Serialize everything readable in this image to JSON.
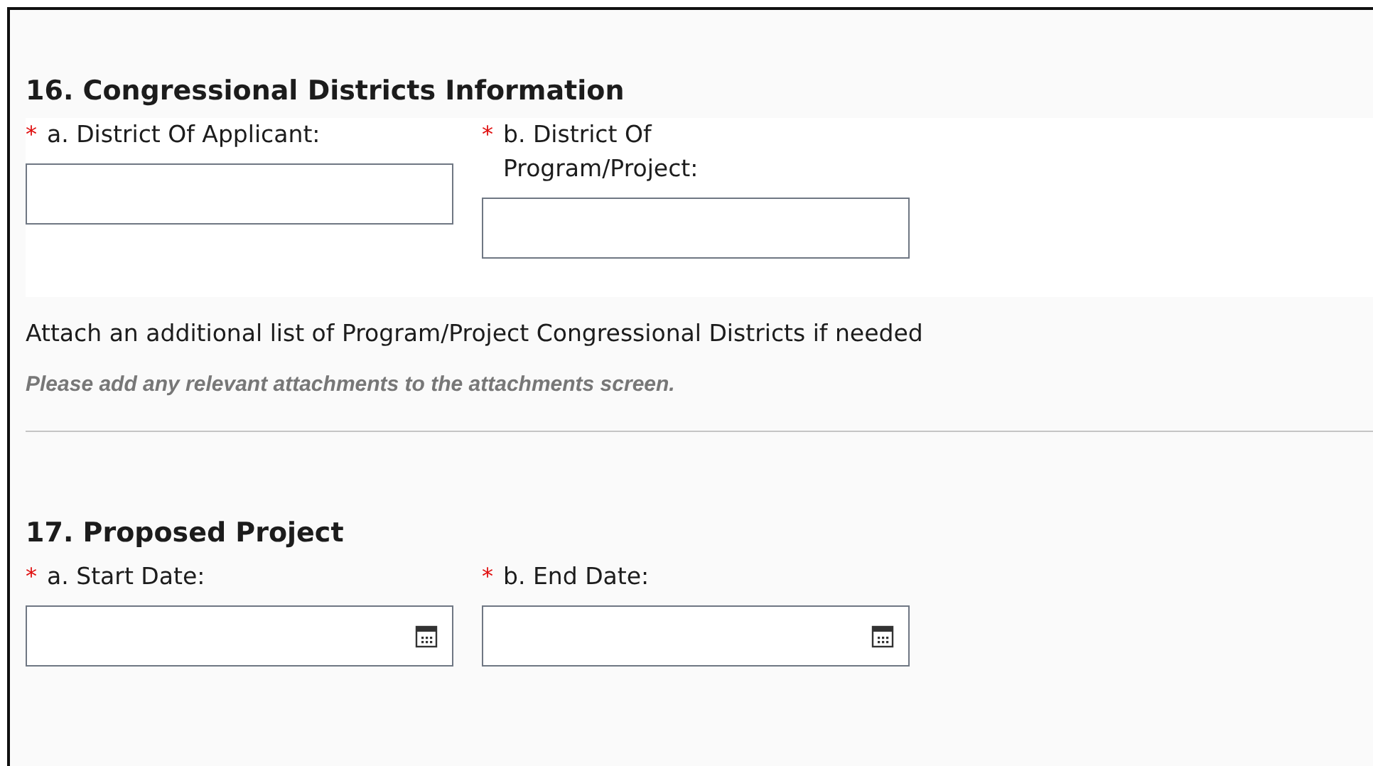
{
  "sections": [
    {
      "heading": "16. Congressional Districts Information",
      "fields": [
        {
          "required_mark": "*",
          "label": "a. District Of Applicant:",
          "kind": "text"
        },
        {
          "required_mark": "*",
          "label": "b. District Of Program/Project:",
          "kind": "text"
        }
      ],
      "note": "Attach an additional list of Program/Project Congressional Districts if needed",
      "hint": "Please add any relevant attachments to the attachments screen."
    },
    {
      "heading": "17. Proposed Project",
      "fields": [
        {
          "required_mark": "*",
          "label": "a. Start Date:",
          "kind": "date"
        },
        {
          "required_mark": "*",
          "label": "b. End Date:",
          "kind": "date"
        }
      ]
    }
  ]
}
